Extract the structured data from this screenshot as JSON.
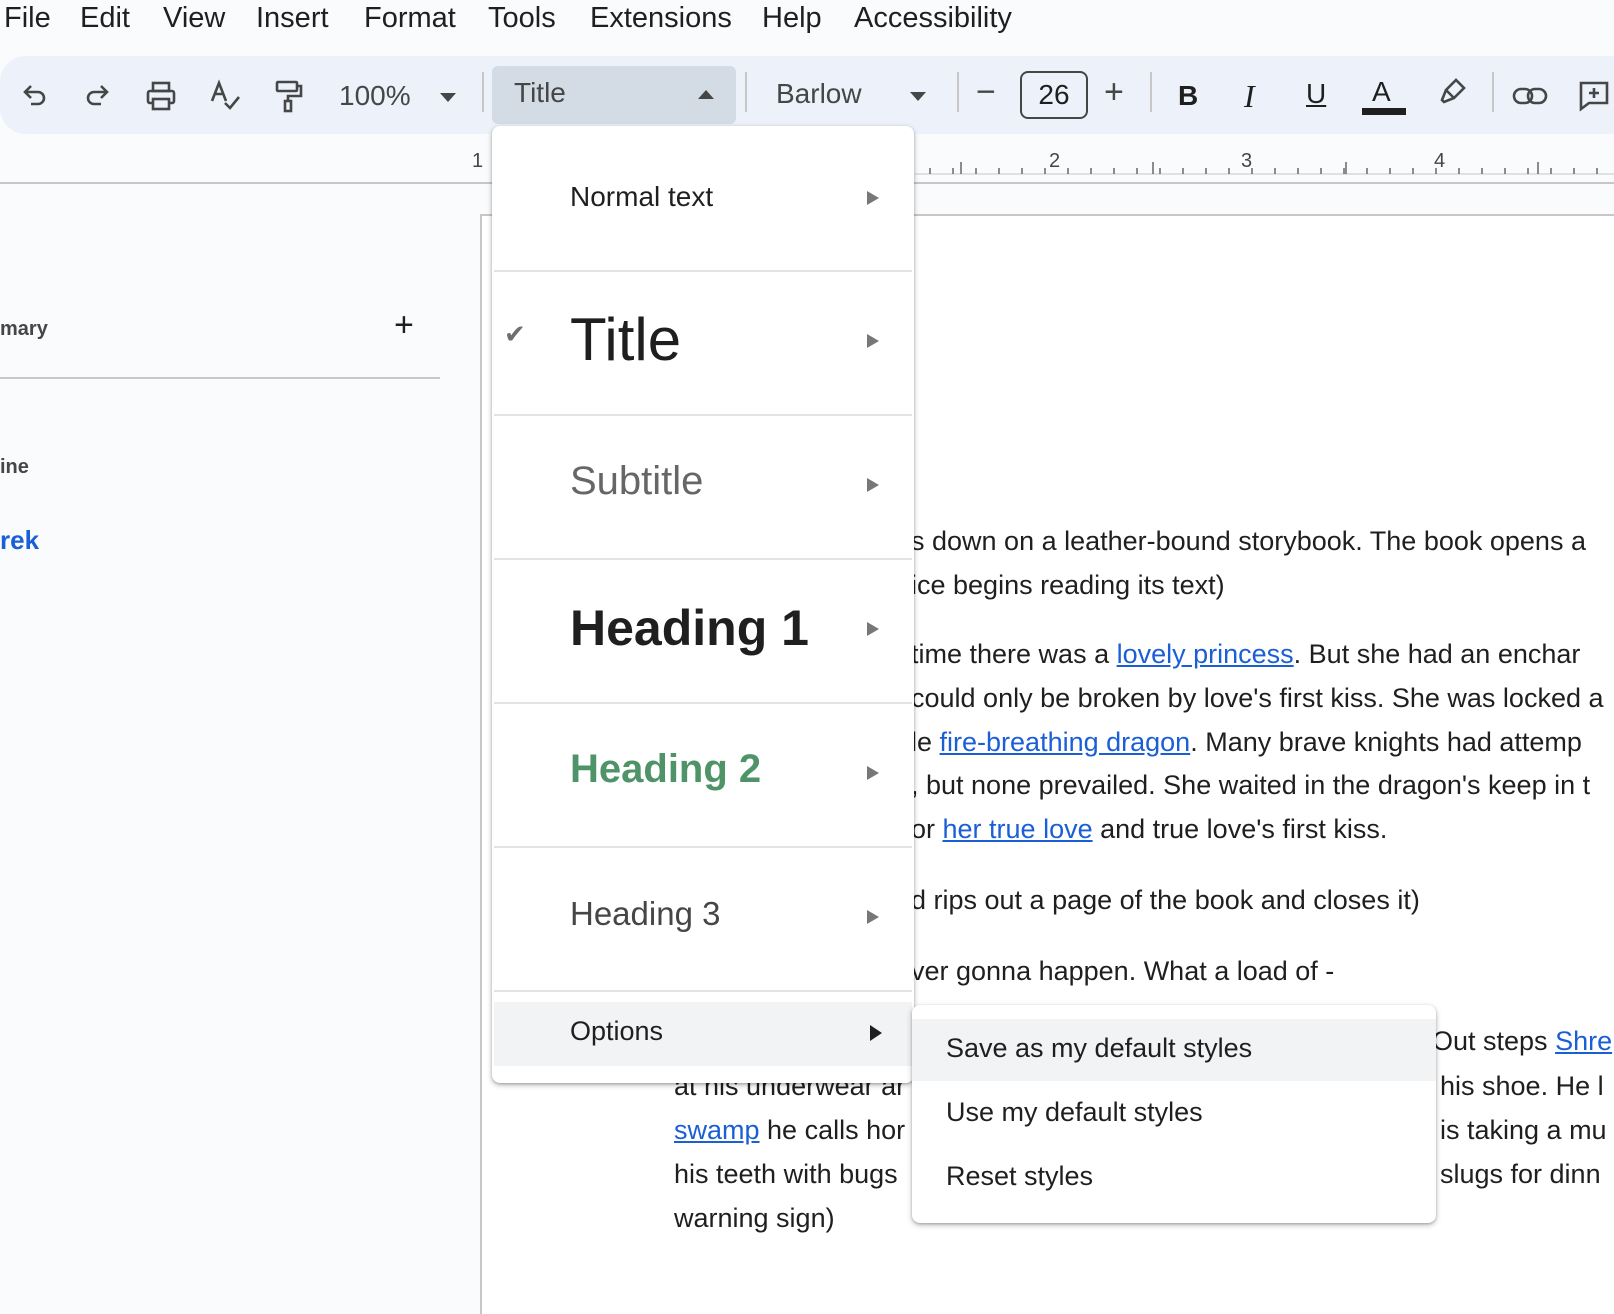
{
  "menubar": {
    "items": [
      "File",
      "Edit",
      "View",
      "Insert",
      "Format",
      "Tools",
      "Extensions",
      "Help",
      "Accessibility"
    ]
  },
  "toolbar": {
    "undo_icon": "undo-icon",
    "redo_icon": "redo-icon",
    "print_icon": "print-icon",
    "spellcheck_icon": "spellcheck-icon",
    "paint_format_icon": "paint-format-icon",
    "zoom": "100%",
    "style": "Title",
    "font": "Barlow",
    "font_size": "26",
    "decrease_label": "−",
    "increase_label": "+",
    "bold_label": "B",
    "italic_label": "I",
    "underline_label": "U",
    "text_color_label": "A",
    "highlight_icon": "highlighter-icon",
    "link_icon": "link-icon",
    "comment_icon": "add-comment-icon"
  },
  "ruler": {
    "numbers": [
      "1",
      "2",
      "3",
      "4"
    ]
  },
  "sidebar": {
    "summary_label": "mary",
    "add_label": "+",
    "outline_label": "ine",
    "outline_item": "rek"
  },
  "document": {
    "line1": "s down on a leather-bound storybook. The book opens a",
    "line2": "ice begins reading its text)",
    "line3_pre": "time there was a ",
    "line3_link": "lovely princess",
    "line3_post": ". But she had an enchar",
    "line4": "could only be broken by love's first kiss. She was locked a",
    "line5_pre": "le ",
    "line5_link": "fire-breathing dragon",
    "line5_post": ". Many brave knights had attemp",
    "line6": ", but none prevailed. She waited in the dragon's keep in t",
    "line7_pre": "or ",
    "line7_link": "her true love",
    "line7_post": " and true love's first kiss.",
    "line8": "d rips out a page of the book and closes it)",
    "line9": "ver gonna happen. What a load of -",
    "line10_pre": "Out steps ",
    "line10_link": "Shre",
    "line11a": "at his underwear ar",
    "line11b": "his shoe. He l",
    "line12a_link": "swamp",
    "line12a_post": " he calls hor",
    "line12b": "is taking a mu",
    "line13a": "his teeth with bugs",
    "line13b": "slugs for dinn",
    "line14": "warning sign)"
  },
  "style_menu": {
    "items": [
      {
        "label": "Normal text",
        "checked": false
      },
      {
        "label": "Title",
        "checked": true
      },
      {
        "label": "Subtitle",
        "checked": false
      },
      {
        "label": "Heading 1",
        "checked": false
      },
      {
        "label": "Heading 2",
        "checked": false
      },
      {
        "label": "Heading 3",
        "checked": false
      }
    ],
    "check_mark": "✔",
    "options_label": "Options",
    "heading2_color": "#4f9468"
  },
  "options_submenu": {
    "items": [
      "Save as my default styles",
      "Use my default styles",
      "Reset styles"
    ]
  }
}
